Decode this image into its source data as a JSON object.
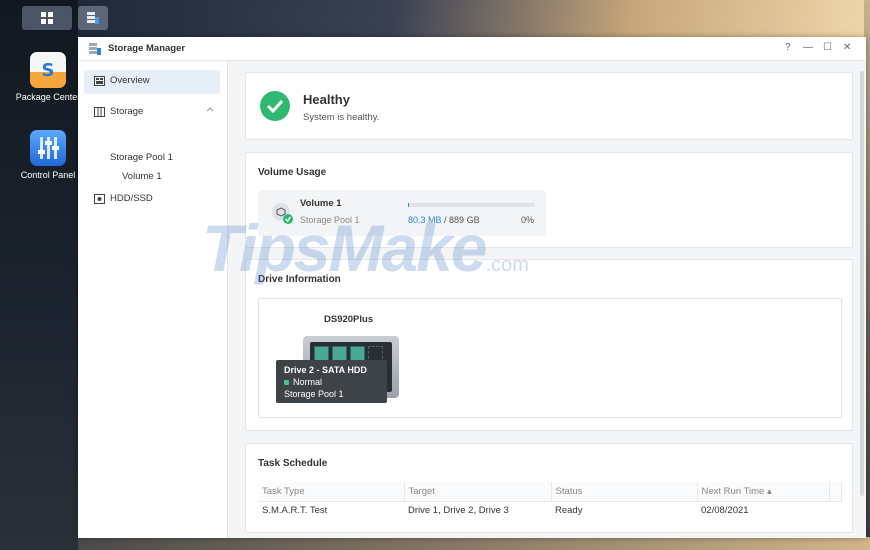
{
  "window": {
    "title": "Storage Manager",
    "controls": [
      "?",
      "—",
      "☐",
      "✕"
    ]
  },
  "desktop": {
    "icons": [
      {
        "label": "Package Center"
      },
      {
        "label": "Control Panel"
      }
    ]
  },
  "sidebar": {
    "items": [
      {
        "label": "Overview",
        "selected": true
      },
      {
        "label": "Storage",
        "expanded": true
      },
      {
        "label": "Storage Pool 1"
      },
      {
        "label": "Volume 1"
      },
      {
        "label": "HDD/SSD"
      }
    ]
  },
  "health": {
    "title": "Healthy",
    "subtitle": "System is healthy.",
    "color": "#2eb872"
  },
  "volume_usage": {
    "title": "Volume Usage",
    "name": "Volume 1",
    "pool": "Storage Pool 1",
    "used": "80.3 MB",
    "total": "/ 889 GB",
    "percent": "0%",
    "fill_fraction": 0.001
  },
  "drive_info": {
    "title": "Drive Information",
    "model": "DS920Plus",
    "bays": [
      "1",
      "2",
      "3",
      "4"
    ],
    "tooltip": {
      "title": "Drive 2 - SATA HDD",
      "status": "Normal",
      "pool": "Storage Pool 1"
    }
  },
  "watermark": {
    "main": "TipsMake",
    "suffix": ".com"
  },
  "task_schedule": {
    "title": "Task Schedule",
    "columns": [
      "Task Type",
      "Target",
      "Status",
      "Next Run Time ▴"
    ],
    "rows": [
      [
        "S.M.A.R.T. Test",
        "Drive 1, Drive 2, Drive 3",
        "Ready",
        "02/08/2021"
      ]
    ]
  },
  "colors": {
    "accent": "#2c86d6",
    "bay_green": "#4aa897",
    "status_green": "#49c28f"
  }
}
